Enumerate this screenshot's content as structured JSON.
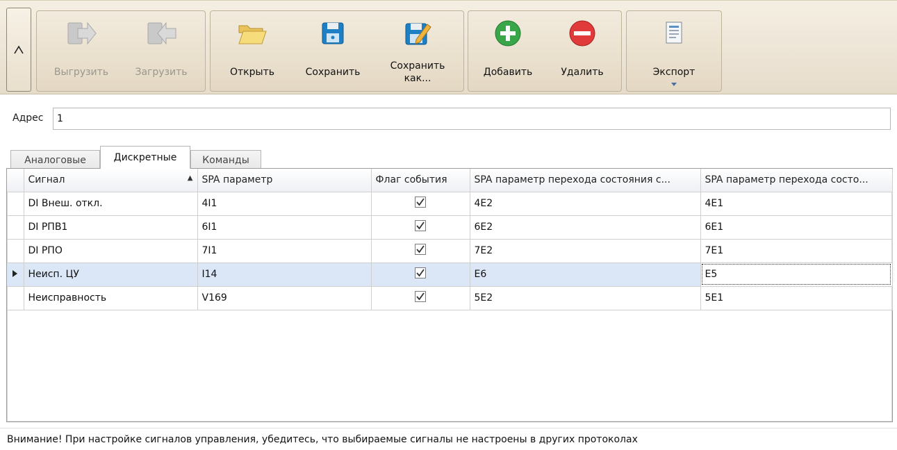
{
  "ribbon": {
    "collapse_glyph": "^",
    "groups": [
      {
        "buttons": [
          {
            "label": "Выгрузить",
            "icon": "upload-arrow-icon",
            "enabled": false
          },
          {
            "label": "Загрузить",
            "icon": "download-arrow-icon",
            "enabled": false
          }
        ]
      },
      {
        "buttons": [
          {
            "label": "Открыть",
            "icon": "folder-open-icon",
            "enabled": true
          },
          {
            "label": "Сохранить",
            "icon": "floppy-disk-icon",
            "enabled": true
          },
          {
            "label": "Сохранить как...",
            "icon": "floppy-disk-edit-icon",
            "enabled": true
          }
        ]
      },
      {
        "buttons": [
          {
            "label": "Добавить",
            "icon": "add-green-icon",
            "enabled": true
          },
          {
            "label": "Удалить",
            "icon": "remove-red-icon",
            "enabled": true
          }
        ]
      },
      {
        "buttons": [
          {
            "label": "Экспорт",
            "icon": "export-document-icon",
            "enabled": true
          }
        ]
      }
    ]
  },
  "address": {
    "label": "Адрес",
    "value": "1"
  },
  "tabs": [
    {
      "label": "Аналоговые",
      "active": false
    },
    {
      "label": "Дискретные",
      "active": true
    },
    {
      "label": "Команды",
      "active": false
    }
  ],
  "grid": {
    "columns": [
      "Сигнал",
      "SPA параметр",
      "Флаг события",
      "SPA параметр перехода состояния с...",
      "SPA параметр перехода состо..."
    ],
    "sort_glyph": "▲",
    "rows": [
      {
        "signal": "DI Внеш. откл.",
        "spa": "4I1",
        "flag": true,
        "trans1": "4E2",
        "trans2": "4E1",
        "selected": false
      },
      {
        "signal": "DI РПВ1",
        "spa": "6I1",
        "flag": true,
        "trans1": "6E2",
        "trans2": "6E1",
        "selected": false
      },
      {
        "signal": "DI РПО",
        "spa": "7I1",
        "flag": true,
        "trans1": "7E2",
        "trans2": "7E1",
        "selected": false
      },
      {
        "signal": "Неисп. ЦУ",
        "spa": "I14",
        "flag": true,
        "trans1": "E6",
        "trans2": "E5",
        "selected": true
      },
      {
        "signal": "Неисправность",
        "spa": "V169",
        "flag": true,
        "trans1": "5E2",
        "trans2": "5E1",
        "selected": false
      }
    ]
  },
  "status_text": "Внимание! При настройке сигналов управления, убедитесь, что выбираемые сигналы не настроены в других протоколах"
}
